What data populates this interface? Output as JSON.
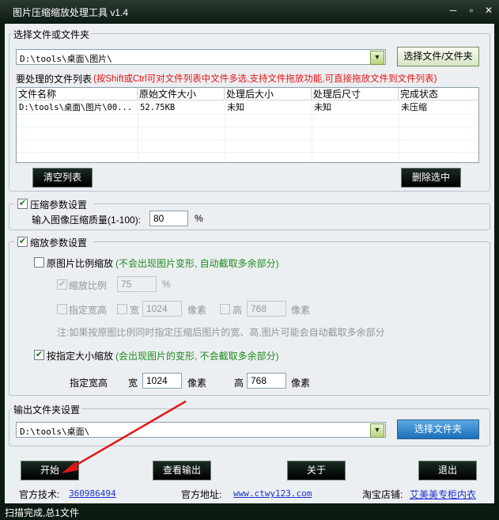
{
  "window": {
    "title": "图片压缩缩放处理工具 v1.4",
    "min": "─",
    "max": "▫",
    "close": "✕"
  },
  "source": {
    "group_label": "选择文件或文件夹",
    "path_value": "D:\\tools\\桌面\\图片\\",
    "choose_button": "选择文件/文件夹",
    "list_label": "要处理的文件列表",
    "list_hint": "(按Shift或Ctrl可对文件列表中文件多选,支持文件拖放功能,可直接拖放文件到文件列表)",
    "columns": [
      "文件名称",
      "原始文件大小",
      "处理后大小",
      "处理后尺寸",
      "完成状态"
    ],
    "rows": [
      [
        "D:\\tools\\桌面\\图片\\00...",
        "52.75KB",
        "未知",
        "未知",
        "未压缩"
      ]
    ],
    "clear_button": "清空列表",
    "delete_button": "删除选中"
  },
  "compress": {
    "group_label": "压缩参数设置",
    "checked": true,
    "quality_label": "输入图像压缩质量(1-100):",
    "quality_value": "80",
    "quality_unit": "%"
  },
  "scale": {
    "group_label": "缩放参数设置",
    "checked": true,
    "ratio_option_label": "原图片比例缩放",
    "ratio_option_note": "(不会出现图片变形, 自动截取多余部分)",
    "ratio_option_checked": false,
    "ratio_label": "缩放比例",
    "ratio_checked": true,
    "ratio_value": "75",
    "ratio_unit": "%",
    "fixed_wh_label": "指定宽高",
    "width_label": "宽",
    "width_value": "1024",
    "height_label": "高",
    "height_value": "768",
    "px_unit": "像素",
    "note": "注:如果按原图比例同时指定压缩后图片的宽、高,图片可能会自动截取多余部分",
    "size_option_label": "按指定大小缩放",
    "size_option_note": "(会出现图片的变形, 不会截取多余部分)",
    "size_option_checked": true,
    "size_wh_label": "指定宽高",
    "size_width_label": "宽",
    "size_width_value": "1024",
    "size_height_label": "高",
    "size_height_value": "768"
  },
  "output": {
    "group_label": "输出文件夹设置",
    "path_value": "D:\\tools\\桌面\\",
    "choose_button": "选择文件夹"
  },
  "actions": {
    "start": "开始",
    "view_output": "查看输出",
    "about": "关于",
    "exit": "退出"
  },
  "footer": {
    "tech_label": "官方技术:",
    "tech_value": "360986494",
    "site_label": "官方地址:",
    "site_value": "www.ctwy123.com",
    "shop_label": "淘宝店铺:",
    "shop_value": "艾美美专柜内衣"
  },
  "status": {
    "text": "扫描完成,总1文件"
  }
}
